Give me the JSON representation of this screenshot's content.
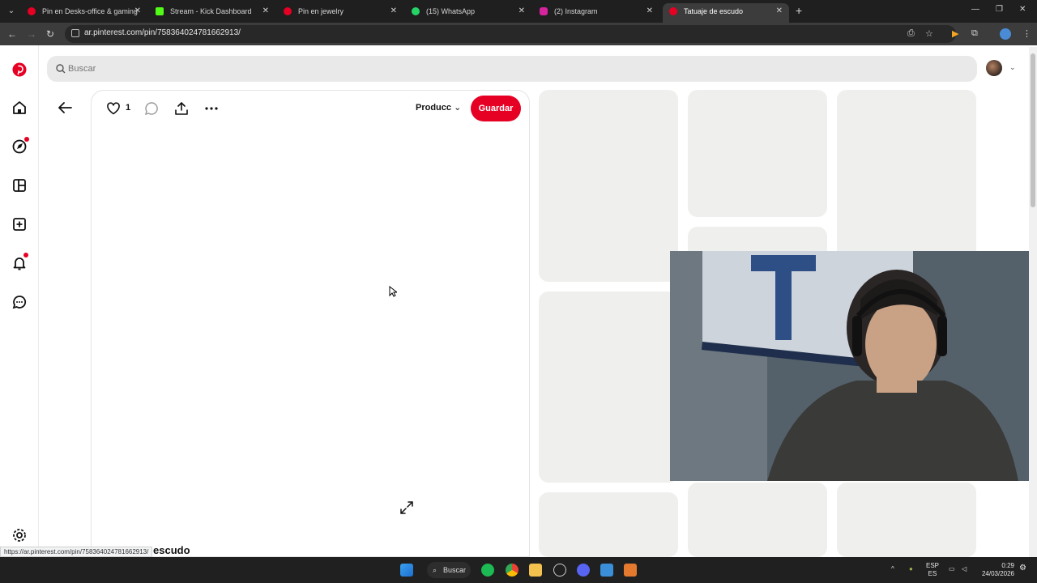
{
  "browser": {
    "tabs": [
      {
        "title": "Pin en Desks-office & gaming",
        "favicon_color": "#e60023",
        "active": false
      },
      {
        "title": "Stream - Kick Dashboard",
        "favicon_color": "#53fc18",
        "active": false
      },
      {
        "title": "Pin en jewelry",
        "favicon_color": "#e60023",
        "active": false
      },
      {
        "title": "(15) WhatsApp",
        "favicon_color": "#25d366",
        "active": false
      },
      {
        "title": "(2) Instagram",
        "favicon_color": "#d6249f",
        "active": false
      },
      {
        "title": "Tatuaje de escudo",
        "favicon_color": "#e60023",
        "active": true
      }
    ],
    "url": "ar.pinterest.com/pin/758364024781662913/",
    "status_url": "https://ar.pinterest.com/pin/758364024781662913/"
  },
  "pinterest": {
    "search_placeholder": "Buscar",
    "brand_color": "#e60023",
    "sidebar_icons": [
      "pinterest-logo-icon",
      "home-icon",
      "explore-icon",
      "boards-icon",
      "create-icon",
      "notifications-icon",
      "messages-icon",
      "settings-icon"
    ],
    "pin": {
      "like_count": "1",
      "product_label": "Producc",
      "save_label": "Guardar",
      "title_partial": "escudo"
    }
  },
  "taskbar": {
    "search_label": "Buscar",
    "lang_top": "ESP",
    "lang_bottom": "ES",
    "time": "0:29",
    "date": "24/03/2026"
  }
}
